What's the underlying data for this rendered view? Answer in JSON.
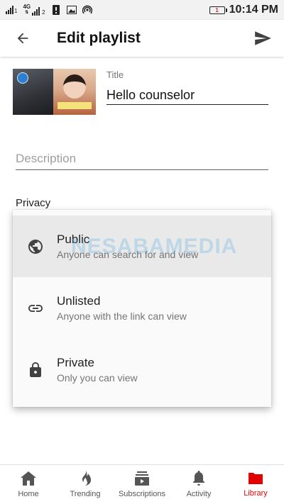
{
  "status_bar": {
    "sim1": "1",
    "network": "4G",
    "sim2": "2",
    "battery": "1",
    "time": "10:14 PM"
  },
  "app_bar": {
    "title": "Edit playlist",
    "back_icon": "arrow-back-icon",
    "send_icon": "send-icon"
  },
  "form": {
    "title_label": "Title",
    "title_value": "Hello counselor",
    "description_placeholder": "Description",
    "privacy_label": "Privacy"
  },
  "privacy_menu": {
    "items": [
      {
        "title": "Public",
        "subtitle": "Anyone can search for and view",
        "icon": "globe-icon",
        "selected": true
      },
      {
        "title": "Unlisted",
        "subtitle": "Anyone with the link can view",
        "icon": "link-icon",
        "selected": false
      },
      {
        "title": "Private",
        "subtitle": "Only you can view",
        "icon": "lock-icon",
        "selected": false
      }
    ]
  },
  "watermark": "NESABAMEDIA",
  "bottom_nav": {
    "items": [
      {
        "label": "Home",
        "icon": "home-icon"
      },
      {
        "label": "Trending",
        "icon": "flame-icon"
      },
      {
        "label": "Subscriptions",
        "icon": "subscriptions-icon"
      },
      {
        "label": "Activity",
        "icon": "bell-icon"
      },
      {
        "label": "Library",
        "icon": "folder-icon",
        "active": true
      }
    ]
  },
  "colors": {
    "accent": "#e00000",
    "text_primary": "#212121",
    "text_secondary": "#757575",
    "selected_bg": "#e9e9e9"
  }
}
